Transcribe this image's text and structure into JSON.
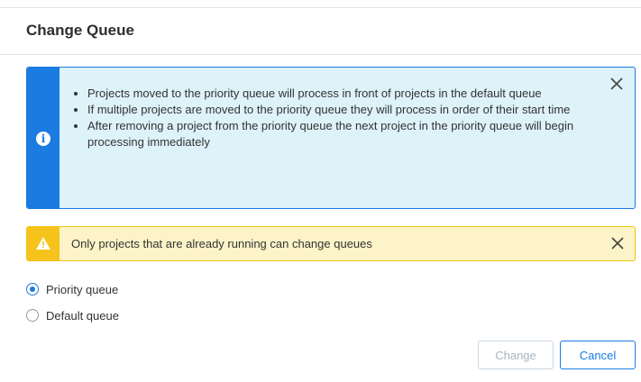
{
  "dialog": {
    "title": "Change Queue"
  },
  "info_alert": {
    "icon": "info-icon",
    "color": "#1b7be0",
    "background": "#def2fa",
    "items": [
      "Projects moved to the priority queue will process in front of projects in the default queue",
      "If multiple projects are moved to the priority queue they will process in order of their start time",
      "After removing a project from the priority queue the next project in the priority queue will begin processing immediately"
    ]
  },
  "warning_alert": {
    "icon": "warning-icon",
    "color": "#f6c31c",
    "background": "#fdf3c8",
    "text": "Only projects that are already running can change queues"
  },
  "queue_options": [
    {
      "label": "Priority queue",
      "selected": true
    },
    {
      "label": "Default queue",
      "selected": false
    }
  ],
  "buttons": {
    "change_label": "Change",
    "change_enabled": false,
    "cancel_label": "Cancel"
  }
}
